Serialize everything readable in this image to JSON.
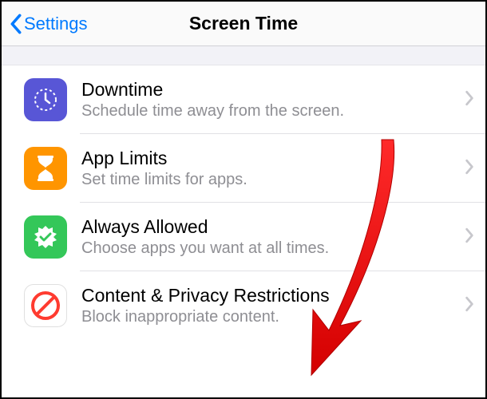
{
  "header": {
    "back_label": "Settings",
    "title": "Screen Time"
  },
  "rows": [
    {
      "title": "Downtime",
      "subtitle": "Schedule time away from the screen."
    },
    {
      "title": "App Limits",
      "subtitle": "Set time limits for apps."
    },
    {
      "title": "Always Allowed",
      "subtitle": "Choose apps you want at all times."
    },
    {
      "title": "Content & Privacy Restrictions",
      "subtitle": "Block inappropriate content."
    }
  ]
}
